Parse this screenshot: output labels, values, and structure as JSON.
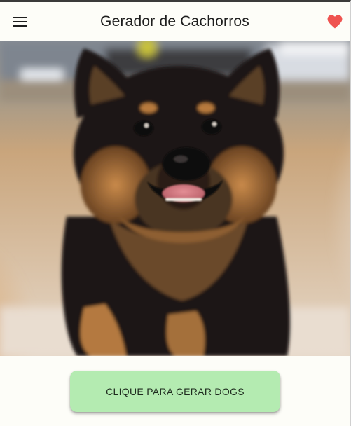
{
  "appbar": {
    "title": "Gerador de Cachorros",
    "menu_icon": "menu-icon",
    "favorite_icon": "heart-icon",
    "favorite_color": "#ef5350"
  },
  "photo": {
    "subject": "dog-photo"
  },
  "actions": {
    "generate_label": "CLIQUE PARA GERAR DOGS",
    "generate_color": "#b4ebb1"
  }
}
